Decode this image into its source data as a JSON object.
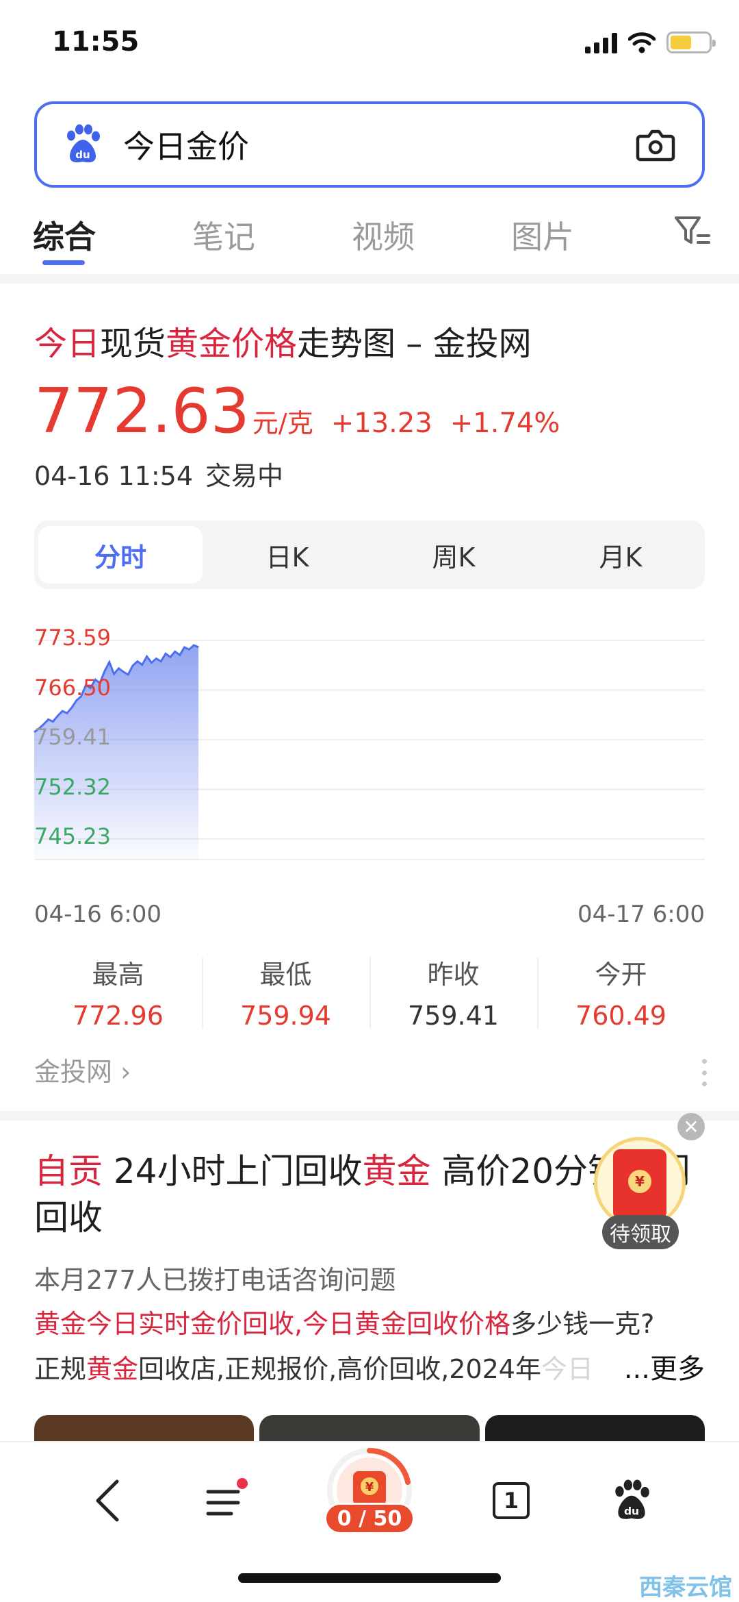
{
  "status_bar": {
    "time": "11:55"
  },
  "search": {
    "query": "今日金价"
  },
  "tabs": [
    {
      "label": "综合",
      "active": true
    },
    {
      "label": "笔记"
    },
    {
      "label": "视频"
    },
    {
      "label": "图片"
    }
  ],
  "card1": {
    "title_parts": [
      "今日",
      "现货",
      "黄金价格",
      "走势图 – 金投网"
    ],
    "price": "772.63",
    "unit": "元/克",
    "change": "+13.23",
    "change_pct": "+1.74%",
    "date": "04-16 11:54",
    "status": "交易中",
    "period_tabs": [
      "分时",
      "日K",
      "周K",
      "月K"
    ],
    "active_period": "分时",
    "x_start": "04-16 6:00",
    "x_end": "04-17 6:00",
    "stats": [
      {
        "label": "最高",
        "value": "772.96"
      },
      {
        "label": "最低",
        "value": "759.94"
      },
      {
        "label": "昨收",
        "value": "759.41"
      },
      {
        "label": "今开",
        "value": "760.49"
      }
    ],
    "source": "金投网 ›"
  },
  "chart_data": {
    "type": "area",
    "y_ticks": [
      "773.59",
      "766.50",
      "759.41",
      "752.32",
      "745.23"
    ],
    "ylim": [
      745.23,
      773.59
    ],
    "xlim": [
      "04-16 6:00",
      "04-17 6:00"
    ],
    "grid": true,
    "baseline": 759.41,
    "series": [
      {
        "values": [
          760.49,
          761.0,
          761.6,
          762.3,
          762.0,
          762.8,
          763.5,
          763.2,
          764.0,
          765.0,
          765.6,
          767.2,
          766.8,
          768.0,
          767.5,
          769.2,
          770.5,
          768.8,
          769.6,
          769.1,
          768.7,
          770.0,
          770.6,
          770.1,
          771.3,
          770.4,
          771.0,
          770.6,
          771.7,
          771.2,
          772.0,
          771.5,
          772.6,
          772.3,
          772.9,
          772.63
        ]
      }
    ],
    "elapsed_fraction": 0.245
  },
  "card2": {
    "title_parts": [
      "自贡",
      " 24小时上门回收",
      "黄金",
      " 高价20分钟上门回收"
    ],
    "meta": "本月277人已拨打电话咨询问题",
    "desc_parts": [
      "黄金今日实时金价回收,今日黄金回收价格",
      "多少钱一克?",
      "正规",
      "黄金",
      "回收店,正规报价,高价回收,2024年",
      "今日"
    ],
    "more": "...更多",
    "envelope_label": "待领取"
  },
  "bottom_bar": {
    "tab_count": "1",
    "progress": "0 / 50"
  },
  "watermark": "西秦云馆",
  "colors": {
    "accent": "#4e6ef2",
    "rise": "#e53a2f",
    "fall": "#3aa865",
    "neutral": "#999999"
  }
}
